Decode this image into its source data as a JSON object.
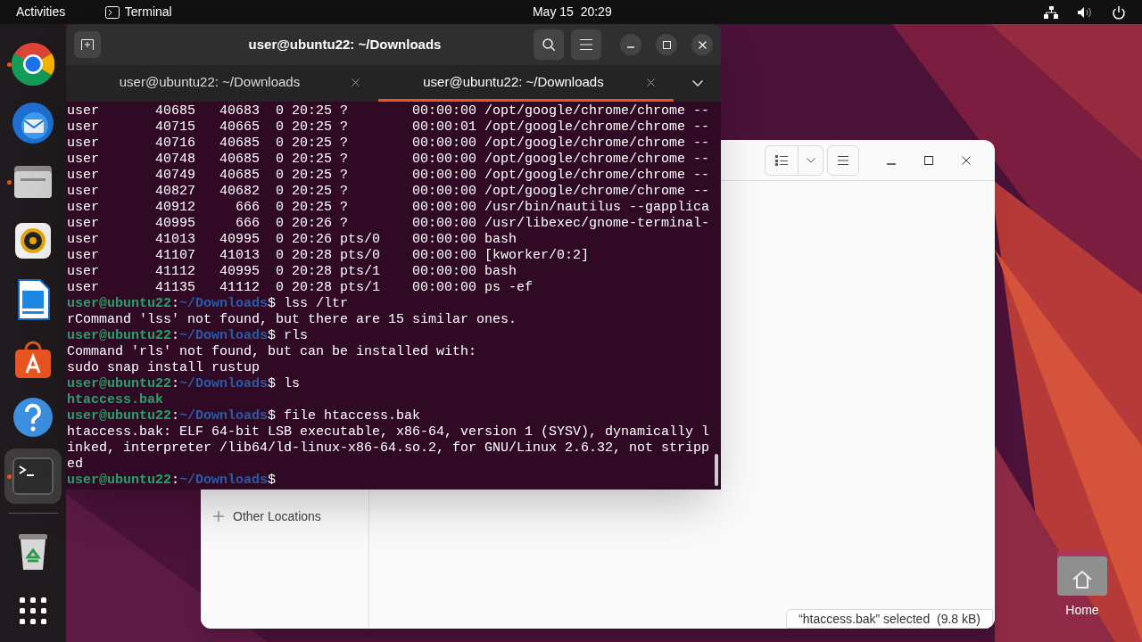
{
  "top_bar": {
    "activities": "Activities",
    "app_name": "Terminal",
    "clock": "May 15  20:29"
  },
  "dock": [
    {
      "kind": "chrome",
      "running": true,
      "selected": false
    },
    {
      "kind": "mail",
      "running": false,
      "selected": false
    },
    {
      "kind": "files",
      "running": true,
      "selected": false
    },
    {
      "kind": "music",
      "running": false,
      "selected": false
    },
    {
      "kind": "writer",
      "running": false,
      "selected": false
    },
    {
      "kind": "store",
      "running": false,
      "selected": false
    },
    {
      "kind": "help",
      "running": false,
      "selected": false
    },
    {
      "kind": "terminal",
      "running": true,
      "selected": true
    },
    {
      "kind": "trash",
      "running": false,
      "selected": false
    },
    {
      "kind": "apps",
      "running": false,
      "selected": false
    }
  ],
  "files_window": {
    "sidebar_items": [
      {
        "label": "Other Locations"
      }
    ],
    "status": "“htaccess.bak” selected  (9.8 kB)"
  },
  "desktop_icons": [
    {
      "label": "Home"
    }
  ],
  "terminal": {
    "title": "user@ubuntu22: ~/Downloads",
    "tabs": [
      {
        "label": "user@ubuntu22: ~/Downloads",
        "selected": false
      },
      {
        "label": "user@ubuntu22: ~/Downloads",
        "selected": true
      }
    ],
    "lines": [
      [
        {
          "kind": "plain",
          "text": "user       40685   40683  0 20:25 ?        00:00:00 /opt/google/chrome/chrome --"
        }
      ],
      [
        {
          "kind": "plain",
          "text": "user       40715   40665  0 20:25 ?        00:00:01 /opt/google/chrome/chrome --"
        }
      ],
      [
        {
          "kind": "plain",
          "text": "user       40716   40685  0 20:25 ?        00:00:00 /opt/google/chrome/chrome --"
        }
      ],
      [
        {
          "kind": "plain",
          "text": "user       40748   40685  0 20:25 ?        00:00:00 /opt/google/chrome/chrome --"
        }
      ],
      [
        {
          "kind": "plain",
          "text": "user       40749   40685  0 20:25 ?        00:00:00 /opt/google/chrome/chrome --"
        }
      ],
      [
        {
          "kind": "plain",
          "text": "user       40827   40682  0 20:25 ?        00:00:00 /opt/google/chrome/chrome --"
        }
      ],
      [
        {
          "kind": "plain",
          "text": "user       40912     666  0 20:25 ?        00:00:00 /usr/bin/nautilus --gapplica"
        }
      ],
      [
        {
          "kind": "plain",
          "text": "user       40995     666  0 20:26 ?        00:00:00 /usr/libexec/gnome-terminal-"
        }
      ],
      [
        {
          "kind": "plain",
          "text": "user       41013   40995  0 20:26 pts/0    00:00:00 bash"
        }
      ],
      [
        {
          "kind": "plain",
          "text": "user       41107   41013  0 20:28 pts/0    00:00:00 [kworker/0:2]"
        }
      ],
      [
        {
          "kind": "plain",
          "text": "user       41112   40995  0 20:28 pts/1    00:00:00 bash"
        }
      ],
      [
        {
          "kind": "plain",
          "text": "user       41135   41112  0 20:28 pts/1    00:00:00 ps -ef"
        }
      ],
      [
        {
          "kind": "user",
          "text": "user@ubuntu22"
        },
        {
          "kind": "plain",
          "text": ":"
        },
        {
          "kind": "path",
          "text": "~/Downloads"
        },
        {
          "kind": "plain",
          "text": "$ lss /ltr"
        }
      ],
      [
        {
          "kind": "plain",
          "text": "rCommand 'lss' not found, but there are 15 similar ones."
        }
      ],
      [
        {
          "kind": "user",
          "text": "user@ubuntu22"
        },
        {
          "kind": "plain",
          "text": ":"
        },
        {
          "kind": "path",
          "text": "~/Downloads"
        },
        {
          "kind": "plain",
          "text": "$ rls"
        }
      ],
      [
        {
          "kind": "plain",
          "text": "Command 'rls' not found, but can be installed with:"
        }
      ],
      [
        {
          "kind": "plain",
          "text": "sudo snap install rustup"
        }
      ],
      [
        {
          "kind": "user",
          "text": "user@ubuntu22"
        },
        {
          "kind": "plain",
          "text": ":"
        },
        {
          "kind": "path",
          "text": "~/Downloads"
        },
        {
          "kind": "plain",
          "text": "$ ls"
        }
      ],
      [
        {
          "kind": "file",
          "text": "htaccess.bak"
        }
      ],
      [
        {
          "kind": "user",
          "text": "user@ubuntu22"
        },
        {
          "kind": "plain",
          "text": ":"
        },
        {
          "kind": "path",
          "text": "~/Downloads"
        },
        {
          "kind": "plain",
          "text": "$ file htaccess.bak"
        }
      ],
      [
        {
          "kind": "plain",
          "text": "htaccess.bak: ELF 64-bit LSB executable, x86-64, version 1 (SYSV), dynamically l"
        }
      ],
      [
        {
          "kind": "plain",
          "text": "inked, interpreter /lib64/ld-linux-x86-64.so.2, for GNU/Linux 2.6.32, not stripp"
        }
      ],
      [
        {
          "kind": "plain",
          "text": "ed"
        }
      ],
      [
        {
          "kind": "user",
          "text": "user@ubuntu22"
        },
        {
          "kind": "plain",
          "text": ":"
        },
        {
          "kind": "path",
          "text": "~/Downloads"
        },
        {
          "kind": "plain",
          "text": "$"
        }
      ]
    ]
  }
}
